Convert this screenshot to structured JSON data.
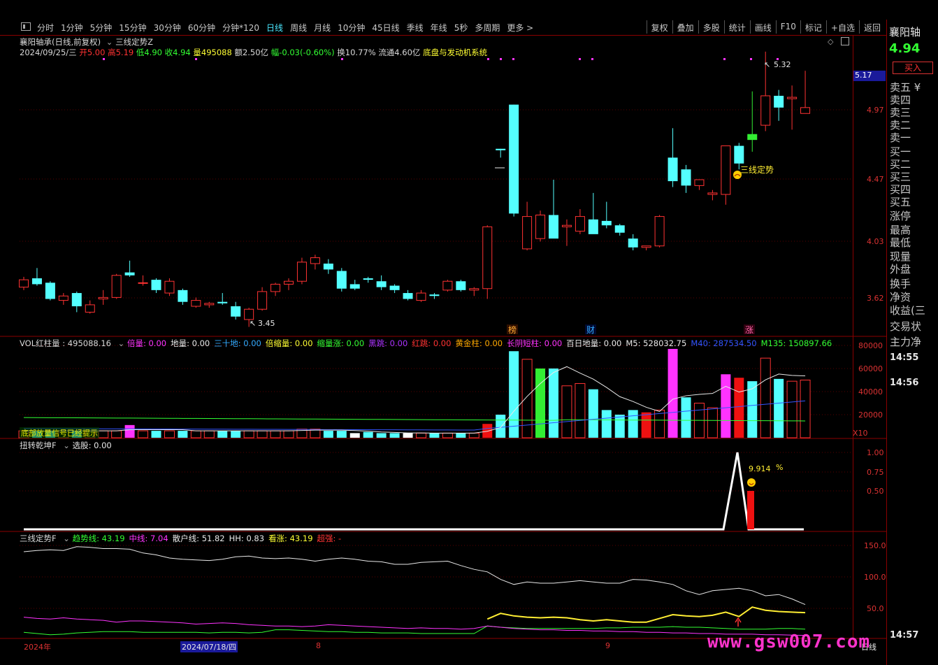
{
  "toolbar": {
    "tabs": [
      "分时",
      "1分钟",
      "5分钟",
      "15分钟",
      "30分钟",
      "60分钟",
      "分钟*120",
      "日线",
      "周线",
      "月线",
      "10分钟",
      "45日线",
      "季线",
      "年线",
      "5秒",
      "多周期",
      "更多 >"
    ],
    "active": "日线",
    "right_buttons": [
      "复权",
      "叠加",
      "多股",
      "统计",
      "画线",
      "F10",
      "标记",
      "+自选",
      "返回"
    ]
  },
  "stock": {
    "title": "襄阳轴承(日线,前复权)",
    "indicator_name": "三线定势Z",
    "date": "2024/09/25/三",
    "open_label": "开",
    "open": "5.00",
    "high_label": "高",
    "high": "5.19",
    "low_label": "低",
    "low": "4.90",
    "close_label": "收",
    "close": "4.94",
    "vol_label": "量",
    "vol": "495088",
    "amount": "额2.50亿",
    "change": "幅-0.03(-0.60%)",
    "turnover": "换10.77%",
    "float": "流通4.60亿",
    "concept": "底盘与发动机系统"
  },
  "price_axis": {
    "ticks": [
      "4.97",
      "4.47",
      "4.03",
      "3.62"
    ],
    "current_tag": "5.17",
    "max_label": "5.32",
    "min_label": "3.45",
    "signal_label": "三线定势"
  },
  "event_markers": [
    "榜",
    "财",
    "涨"
  ],
  "volume_panel": {
    "header": [
      {
        "t": "VOL红柱量 : 495088.16",
        "c": "#d8d8d8"
      },
      {
        "t": "倍量: 0.00",
        "c": "#ff33ff"
      },
      {
        "t": "地量: 0.00",
        "c": "#e8e8e8"
      },
      {
        "t": "三十地: 0.00",
        "c": "#33aaff"
      },
      {
        "t": "倍缩量: 0.00",
        "c": "#ffff33"
      },
      {
        "t": "缩量涨: 0.00",
        "c": "#33ff33"
      },
      {
        "t": "黑跳: 0.00",
        "c": "#aa33ff"
      },
      {
        "t": "红跳: 0.00",
        "c": "#ff3333"
      },
      {
        "t": "黄金柱: 0.00",
        "c": "#ffaa00"
      },
      {
        "t": "长阴短柱: 0.00",
        "c": "#ff33ff"
      },
      {
        "t": "百日地量: 0.00",
        "c": "#e8e8e8"
      },
      {
        "t": "M5: 528032.75",
        "c": "#e8e8e8"
      },
      {
        "t": "M40: 287534.50",
        "c": "#3355ff"
      },
      {
        "t": "M135: 150897.66",
        "c": "#33ff33"
      }
    ],
    "ticks": [
      "80000",
      "60000",
      "40000",
      "20000"
    ],
    "unit": "X10",
    "overlay_text": "底部放量信号已经提示"
  },
  "signal_panel": {
    "header": [
      {
        "t": "扭转乾坤F",
        "c": "#d8d8d8"
      },
      {
        "t": "选股: 0.00",
        "c": "#e8e8e8"
      }
    ],
    "ticks": [
      "1.00",
      "0.75",
      "0.50"
    ],
    "pct_value": "9.914",
    "pct_sign": "%"
  },
  "trend_panel": {
    "header": [
      {
        "t": "三线定势F",
        "c": "#d8d8d8"
      },
      {
        "t": "趋势线: 43.19",
        "c": "#33ff33"
      },
      {
        "t": "中线: 7.04",
        "c": "#ff33ff"
      },
      {
        "t": "散户线: 51.82",
        "c": "#e8e8e8"
      },
      {
        "t": "HH: 0.83",
        "c": "#e8e8e8"
      },
      {
        "t": "看涨: 43.19",
        "c": "#ffff33"
      },
      {
        "t": "超强: -",
        "c": "#ff3333"
      }
    ],
    "ticks": [
      "150.0",
      "100.0",
      "50.0"
    ]
  },
  "date_axis": {
    "labels": [
      "2024年",
      "2024/07/18/四",
      "8",
      "9"
    ],
    "period": "日线"
  },
  "sidebar": {
    "stock_name": "襄阳轴",
    "price": "4.94",
    "buy_button": "买入",
    "items": [
      "卖五 ¥",
      "卖四",
      "卖三",
      "卖二",
      "卖一",
      "买一",
      "买二",
      "买三",
      "买四",
      "买五",
      "涨停",
      "最高",
      "最低",
      "现量",
      "外盘",
      "换手",
      "净资",
      "收益(三",
      "交易状",
      "主力净"
    ],
    "times": [
      "14:55",
      "14:56",
      "14:57"
    ]
  },
  "watermark": "www.gsw007.com",
  "colors": {
    "up": "#ff3232",
    "down": "#54ffff",
    "grid": "#8b0000",
    "accent": "#4ae8ff"
  },
  "chart_data": {
    "type": "candlestick",
    "ohlc": [
      [
        3.72,
        3.79,
        3.7,
        3.77
      ],
      [
        3.78,
        3.85,
        3.73,
        3.74
      ],
      [
        3.75,
        3.76,
        3.63,
        3.64
      ],
      [
        3.63,
        3.68,
        3.6,
        3.66
      ],
      [
        3.68,
        3.69,
        3.55,
        3.59
      ],
      [
        3.55,
        3.63,
        3.54,
        3.6
      ],
      [
        3.64,
        3.7,
        3.6,
        3.65
      ],
      [
        3.65,
        3.81,
        3.64,
        3.8
      ],
      [
        3.82,
        3.9,
        3.79,
        3.8
      ],
      [
        3.75,
        3.8,
        3.73,
        3.75
      ],
      [
        3.77,
        3.78,
        3.68,
        3.7
      ],
      [
        3.68,
        3.78,
        3.66,
        3.76
      ],
      [
        3.7,
        3.71,
        3.6,
        3.62
      ],
      [
        3.59,
        3.65,
        3.58,
        3.63
      ],
      [
        3.6,
        3.62,
        3.58,
        3.61
      ],
      [
        3.62,
        3.68,
        3.6,
        3.61
      ],
      [
        3.59,
        3.62,
        3.5,
        3.52
      ],
      [
        3.5,
        3.58,
        3.45,
        3.57
      ],
      [
        3.57,
        3.72,
        3.56,
        3.69
      ],
      [
        3.69,
        3.75,
        3.66,
        3.74
      ],
      [
        3.74,
        3.78,
        3.7,
        3.76
      ],
      [
        3.76,
        3.92,
        3.74,
        3.89
      ],
      [
        3.88,
        3.94,
        3.84,
        3.92
      ],
      [
        3.88,
        3.91,
        3.81,
        3.84
      ],
      [
        3.83,
        3.85,
        3.69,
        3.71
      ],
      [
        3.74,
        3.77,
        3.7,
        3.71
      ],
      [
        3.78,
        3.79,
        3.75,
        3.77
      ],
      [
        3.76,
        3.8,
        3.7,
        3.72
      ],
      [
        3.73,
        3.74,
        3.68,
        3.7
      ],
      [
        3.68,
        3.7,
        3.63,
        3.64
      ],
      [
        3.63,
        3.7,
        3.62,
        3.68
      ],
      [
        3.67,
        3.68,
        3.64,
        3.66
      ],
      [
        3.7,
        3.77,
        3.69,
        3.76
      ],
      [
        3.76,
        3.77,
        3.69,
        3.7
      ],
      [
        3.7,
        3.72,
        3.66,
        3.71
      ],
      [
        3.71,
        4.14,
        3.64,
        4.13
      ],
      [
        4.66,
        4.66,
        4.6,
        4.65
      ],
      [
        4.96,
        4.96,
        4.2,
        4.22
      ],
      [
        3.98,
        4.3,
        3.97,
        4.2
      ],
      [
        4.05,
        4.24,
        4.03,
        4.21
      ],
      [
        4.21,
        4.45,
        4.06,
        4.05
      ],
      [
        4.13,
        4.18,
        4.0,
        4.14
      ],
      [
        4.1,
        4.25,
        4.08,
        4.2
      ],
      [
        4.18,
        4.36,
        4.13,
        4.08
      ],
      [
        4.17,
        4.3,
        4.12,
        4.14
      ],
      [
        4.14,
        4.15,
        4.07,
        4.09
      ],
      [
        4.05,
        4.08,
        3.97,
        3.99
      ],
      [
        3.99,
        4.0,
        3.97,
        4.0
      ],
      [
        4.0,
        4.21,
        3.99,
        4.2
      ],
      [
        4.6,
        4.8,
        4.4,
        4.44
      ],
      [
        4.52,
        4.55,
        4.36,
        4.41
      ],
      [
        4.41,
        4.45,
        4.38,
        4.45
      ],
      [
        4.35,
        4.38,
        4.31,
        4.36
      ],
      [
        4.35,
        4.6,
        4.28,
        4.68
      ],
      [
        4.68,
        4.7,
        4.52,
        4.56
      ],
      [
        4.76,
        5.05,
        4.64,
        4.72
      ],
      [
        4.82,
        5.32,
        4.78,
        5.02
      ],
      [
        5.02,
        5.06,
        4.85,
        4.94
      ],
      [
        5.0,
        5.09,
        4.79,
        5.01
      ],
      [
        4.9,
        5.19,
        4.9,
        4.94
      ]
    ],
    "bars_shown": 60,
    "ylim": [
      3.4,
      5.4
    ]
  }
}
